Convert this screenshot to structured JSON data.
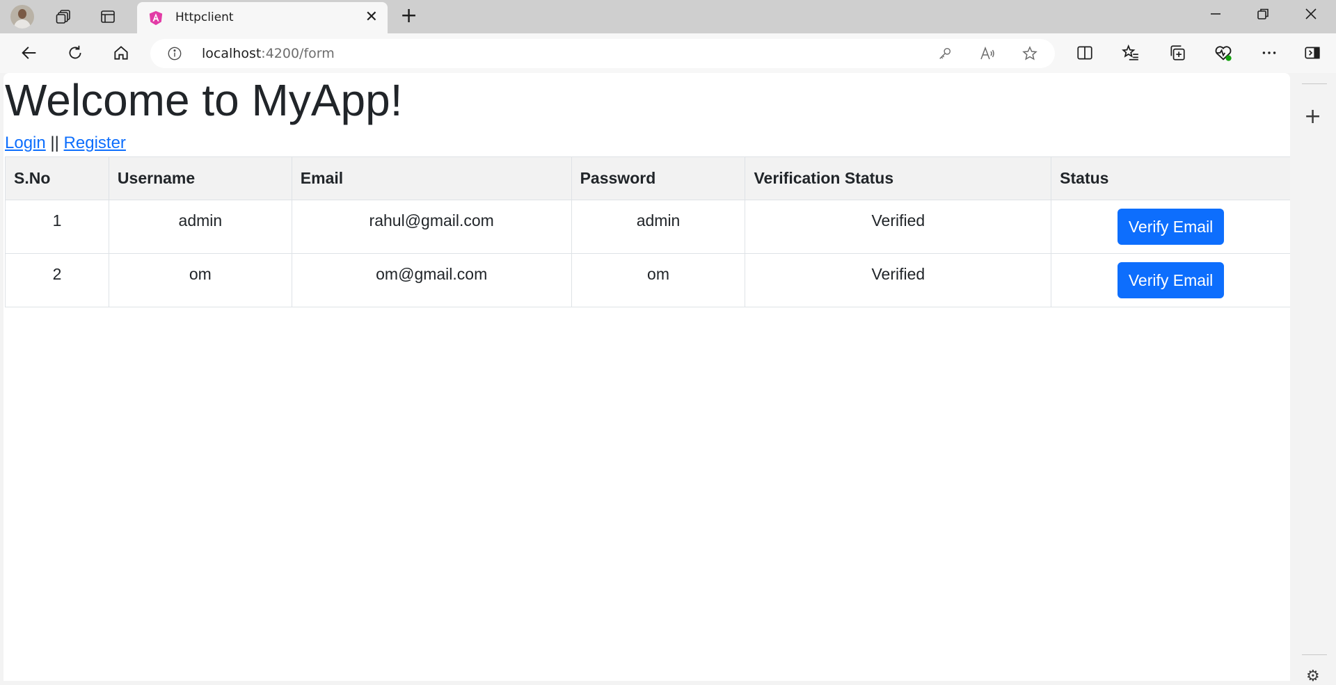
{
  "browser": {
    "tab": {
      "title": "Httpclient"
    },
    "address": {
      "host": "localhost",
      "path": ":4200/form"
    }
  },
  "page": {
    "heading": "Welcome to MyApp!",
    "links": {
      "login": "Login",
      "separator": "||",
      "register": "Register"
    },
    "table": {
      "columns": [
        "S.No",
        "Username",
        "Email",
        "Password",
        "Verification Status",
        "Status"
      ],
      "rows": [
        {
          "sno": "1",
          "username": "admin",
          "email": "rahul@gmail.com",
          "password": "admin",
          "verification": "Verified",
          "action": "Verify Email"
        },
        {
          "sno": "2",
          "username": "om",
          "email": "om@gmail.com",
          "password": "om",
          "verification": "Verified",
          "action": "Verify Email"
        }
      ]
    }
  },
  "colors": {
    "accent": "#0d6efd",
    "header_bg": "#f2f2f2",
    "text": "#212529"
  }
}
